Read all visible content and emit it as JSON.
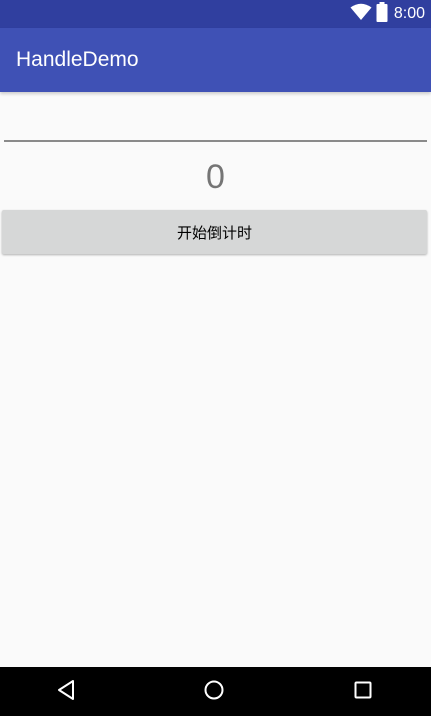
{
  "status_bar": {
    "time": "8:00",
    "icons": [
      "wifi-icon",
      "battery-icon"
    ],
    "color": "#303f9f"
  },
  "app_bar": {
    "title": "HandleDemo",
    "color": "#3f51b5"
  },
  "main": {
    "edit_text": {
      "value": "",
      "placeholder": ""
    },
    "count_text": "0",
    "start_button": {
      "label": "开始倒计时"
    }
  },
  "nav_bar": {
    "buttons": [
      "back-icon",
      "home-icon",
      "recents-icon"
    ]
  }
}
